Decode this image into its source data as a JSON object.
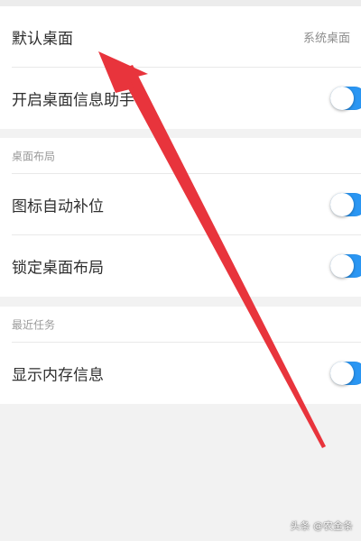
{
  "settings": {
    "default_desktop": {
      "label": "默认桌面",
      "value": "系统桌面"
    },
    "desktop_assistant": {
      "label": "开启桌面信息助手",
      "enabled": true
    }
  },
  "layout_section": {
    "header": "桌面布局",
    "icon_autofill": {
      "label": "图标自动补位",
      "enabled": true
    },
    "lock_layout": {
      "label": "锁定桌面布局",
      "enabled": true
    }
  },
  "recent_section": {
    "header": "最近任务",
    "show_memory": {
      "label": "显示内存信息",
      "enabled": true
    }
  },
  "watermark": {
    "text": "头条 @农金条"
  },
  "colors": {
    "toggle_on": "#2a96f3",
    "arrow": "#e8343c",
    "background": "#f2f2f2",
    "card": "#ffffff"
  }
}
